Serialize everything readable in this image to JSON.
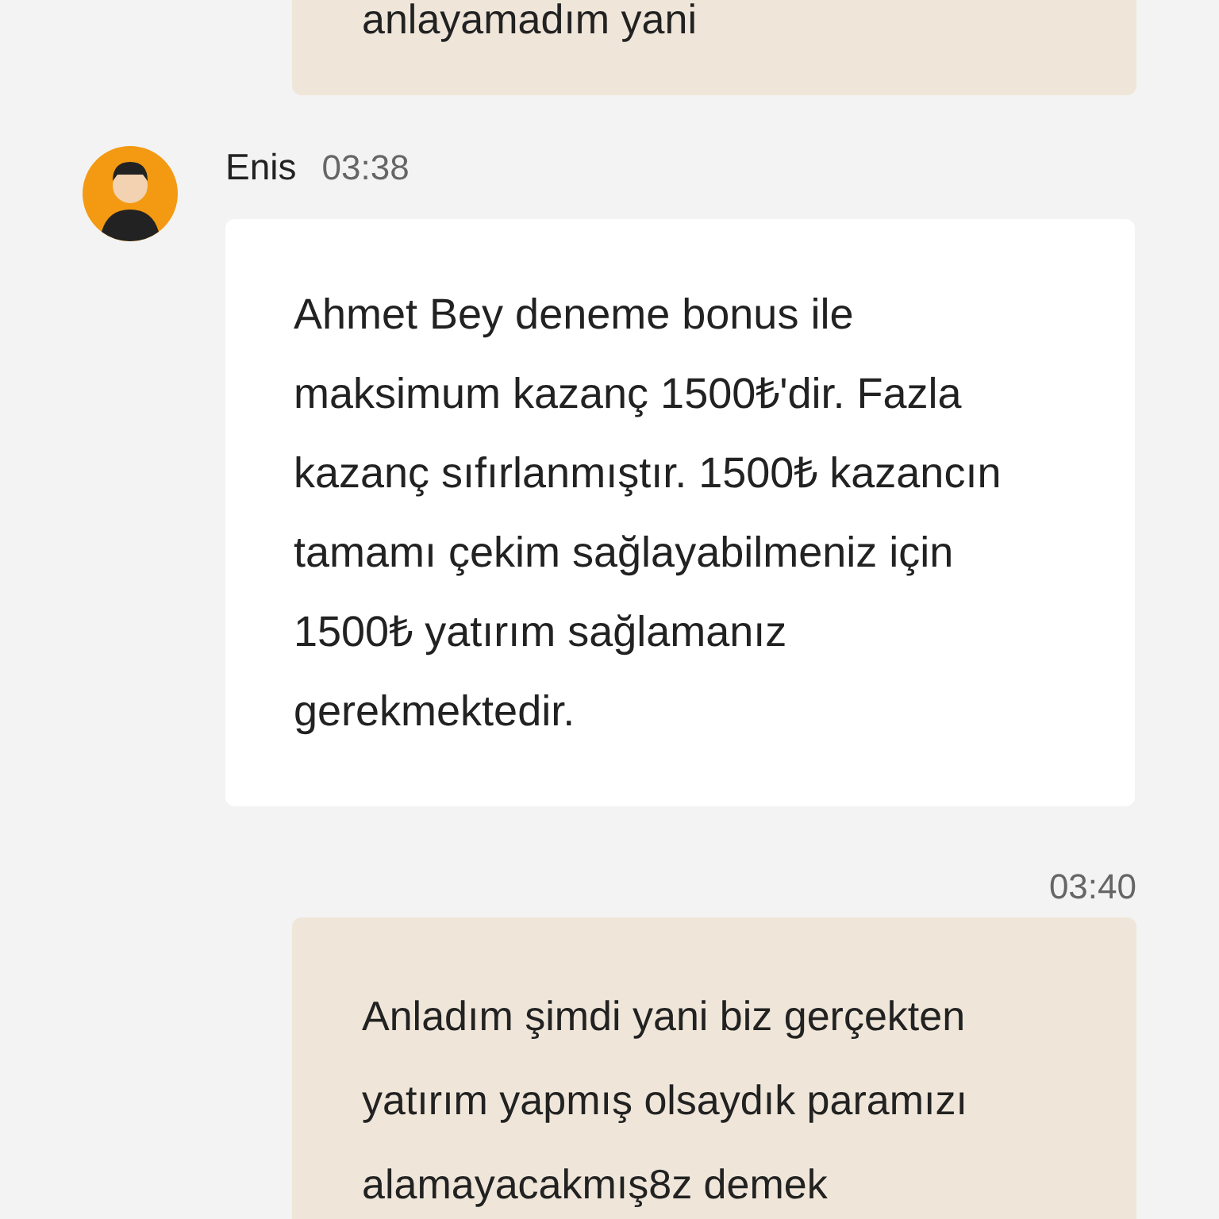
{
  "messages": [
    {
      "kind": "outgoing",
      "text": "anlayamadım yani"
    },
    {
      "kind": "incoming",
      "sender": "Enis",
      "time": "03:38",
      "text": "Ahmet Bey deneme bonus ile maksimum kazanç 1500₺'dir. Fazla kazanç sıfırlanmıştır. 1500₺ kazancın tamamı çekim sağlayabilmeniz için 1500₺ yatırım sağlamanız gerekmektedir."
    },
    {
      "kind": "outgoing",
      "time": "03:40",
      "text": "Anladım şimdi yani biz gerçekten yatırım yapmış olsaydık paramızı alamayacakmış8z demek"
    }
  ]
}
